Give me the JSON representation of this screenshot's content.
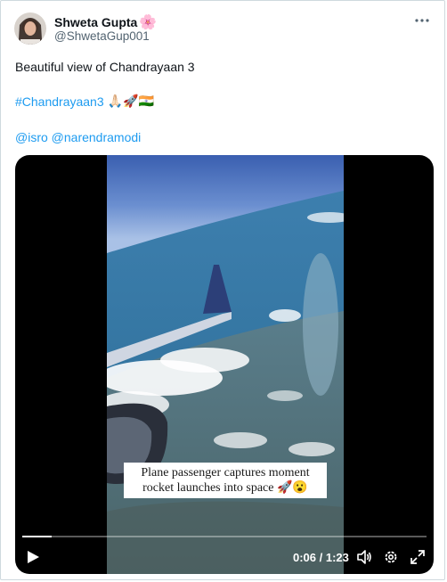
{
  "tweet": {
    "display_name": "Shweta Gupta",
    "name_emoji": "🌸",
    "handle": "@ShwetaGup001",
    "text_line1": "Beautiful view of Chandrayaan 3",
    "hashtag": "#Chandrayaan3",
    "hashtag_emojis": "🙏🏻🚀🇮🇳",
    "mentions": "@isro @narendramodi"
  },
  "video": {
    "caption_line1": "Plane passenger captures moment",
    "caption_line2": "rocket launches into space 🚀😮",
    "current_time": "0:06",
    "duration": "1:23",
    "time_display": "0:06 / 1:23",
    "progress_fraction": 0.072
  },
  "icons": {
    "more": "more-horizontal-icon",
    "play": "play-icon",
    "volume": "volume-icon",
    "settings": "settings-gear-icon",
    "fullscreen": "fullscreen-expand-icon"
  },
  "colors": {
    "link": "#1d9bf0",
    "text": "#0f1419",
    "secondary": "#536471"
  }
}
